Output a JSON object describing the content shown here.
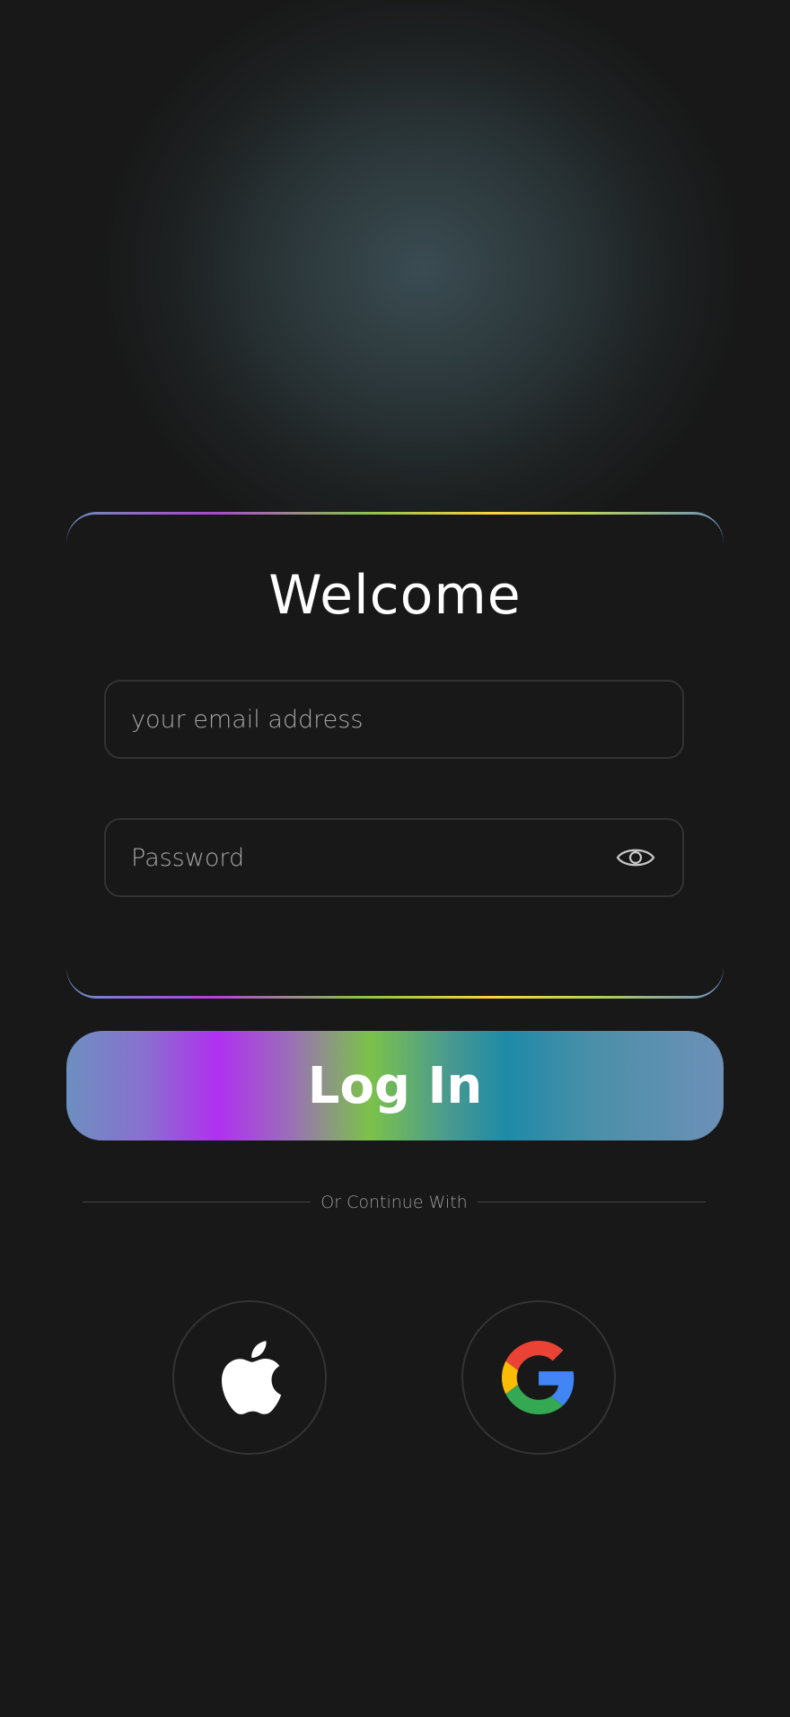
{
  "title": "Welcome",
  "email": {
    "placeholder": "your email address",
    "value": ""
  },
  "password": {
    "placeholder": "Password",
    "value": "",
    "toggle_icon": "eye-icon"
  },
  "login_button": {
    "label": "Log In"
  },
  "divider": {
    "label": "Or Continue With"
  },
  "social": [
    {
      "name": "apple",
      "icon": "apple-icon"
    },
    {
      "name": "google",
      "icon": "google-icon"
    }
  ],
  "colors": {
    "background": "#181818",
    "text": "#ffffff",
    "border": "#333333",
    "gradient": [
      "#6d8fc0",
      "#b030f0",
      "#7cc24a",
      "#1e8aa8",
      "#6d90b8"
    ]
  }
}
